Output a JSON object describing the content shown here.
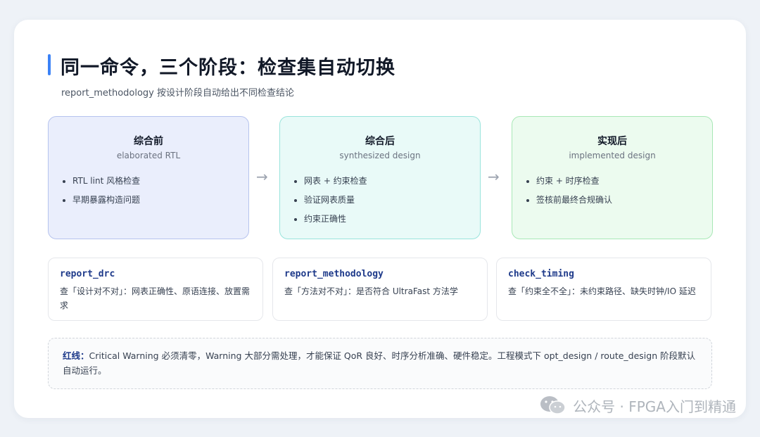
{
  "header": {
    "title": "同一命令，三个阶段：检查集自动切换",
    "subtitle": "report_methodology 按设计阶段自动给出不同检查结论"
  },
  "stages": [
    {
      "title": "综合前",
      "subtitle": "elaborated RTL",
      "items": [
        "RTL lint 风格检查",
        "早期暴露构造问题"
      ]
    },
    {
      "title": "综合后",
      "subtitle": "synthesized design",
      "items": [
        "网表 + 约束检查",
        "验证网表质量",
        "约束正确性"
      ]
    },
    {
      "title": "实现后",
      "subtitle": "implemented design",
      "items": [
        "约束 + 时序检查",
        "签核前最终合规确认"
      ]
    }
  ],
  "arrow_glyph": "→",
  "commands": [
    {
      "name": "report_drc",
      "desc": "查「设计对不对」：网表正确性、原语连接、放置需求"
    },
    {
      "name": "report_methodology",
      "desc": "查「方法对不对」：是否符合 UltraFast 方法学"
    },
    {
      "name": "check_timing",
      "desc": "查「约束全不全」：未约束路径、缺失时钟/IO 延迟"
    }
  ],
  "note": {
    "label": "红线：",
    "text": "Critical Warning 必须清零，Warning 大部分需处理，才能保证 QoR 良好、时序分析准确、硬件稳定。工程模式下 opt_design / route_design 阶段默认自动运行。"
  },
  "watermark": {
    "text": "公众号 · FPGA入门到精通",
    "icon": "wechat-icon"
  },
  "colors": {
    "accent": "#3b82f6",
    "stage1_bg": "#eaeefc",
    "stage2_bg": "#e9faf8",
    "stage3_bg": "#ecfbef",
    "command_text": "#1e3a8a"
  }
}
